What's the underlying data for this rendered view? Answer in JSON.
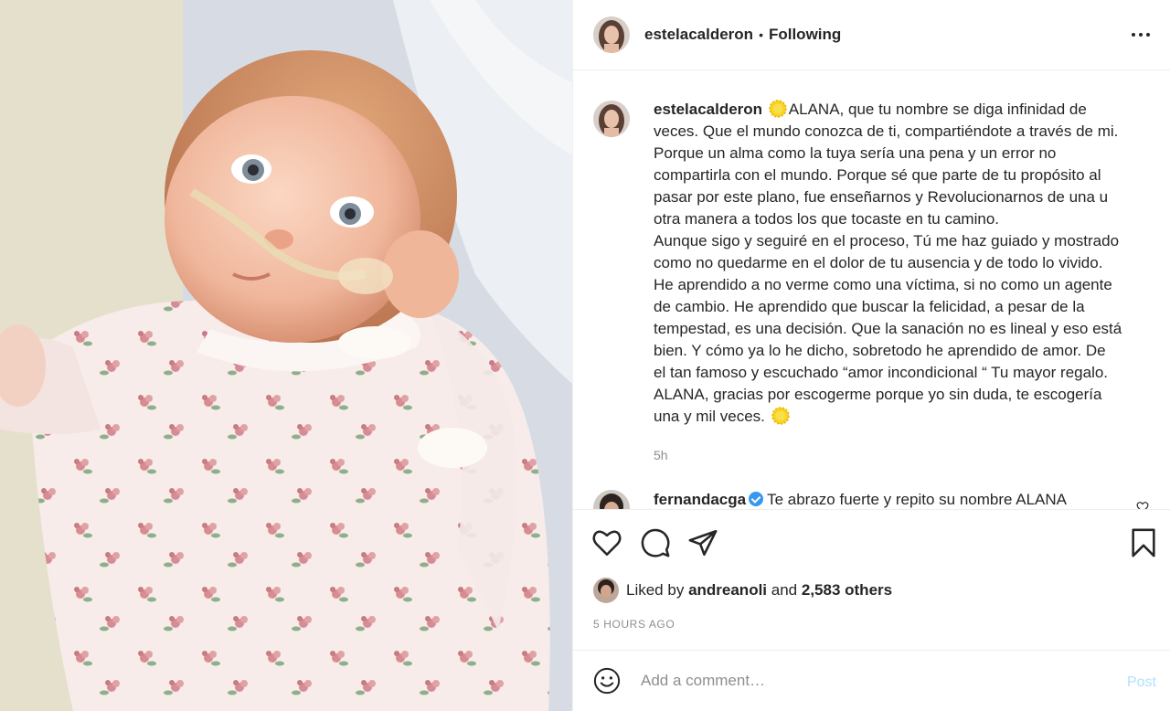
{
  "post": {
    "username": "estelacalderon",
    "separator": "•",
    "follow_status": "Following",
    "caption_lines": [
      "ALANA, que tu nombre se diga infinidad de",
      "veces. Que el mundo conozca de ti, compartiéndote a través de mi.",
      "Porque un alma como la tuya sería una pena y un error no",
      "compartirla con el mundo. Porque sé que parte de tu propósito al",
      "pasar por este plano, fue enseñarnos y Revolucionarnos de una u",
      "otra manera a todos los que tocaste en tu camino.",
      "Aunque sigo y seguiré en el proceso, Tú me haz guiado y mostrado",
      "como no quedarme en el dolor de tu ausencia y de todo lo vivido.",
      "He aprendido a no verme como una víctima, si no como un agente",
      "de cambio. He aprendido que buscar la felicidad, a pesar de la",
      "tempestad, es una decisión. Que la sanación no es lineal y eso está",
      "bien. Y cómo ya lo he dicho, sobretodo he aprendido de amor. De",
      "el tan famoso y escuchado “amor incondicional “ Tu mayor regalo.",
      "ALANA, gracias por escogerme porque yo sin duda, te escogería",
      "una y mil veces."
    ],
    "caption_time": "5h",
    "comment": {
      "username": "fernandacga",
      "text": "Te abrazo fuerte y repito su nombre ALANA"
    },
    "liked_by_prefix": "Liked by",
    "liked_by_user": "andreanoli",
    "liked_by_and": "and",
    "liked_by_others": "2,583 others",
    "timestamp": "5 HOURS AGO",
    "add_comment_placeholder": "Add a comment…",
    "post_button": "Post"
  },
  "icons": {
    "like": "heart-icon",
    "comment": "comment-icon",
    "share": "paper-plane-icon",
    "save": "bookmark-icon",
    "more": "more-options-icon",
    "emoji": "emoji-icon",
    "sun_emoji": "sun-emoji-icon",
    "verified": "verified-badge-icon"
  },
  "colors": {
    "text": "#262626",
    "muted": "#8e8e8e",
    "post_disabled": "#b2dffc",
    "verified": "#3897f0",
    "border": "#efefef"
  }
}
